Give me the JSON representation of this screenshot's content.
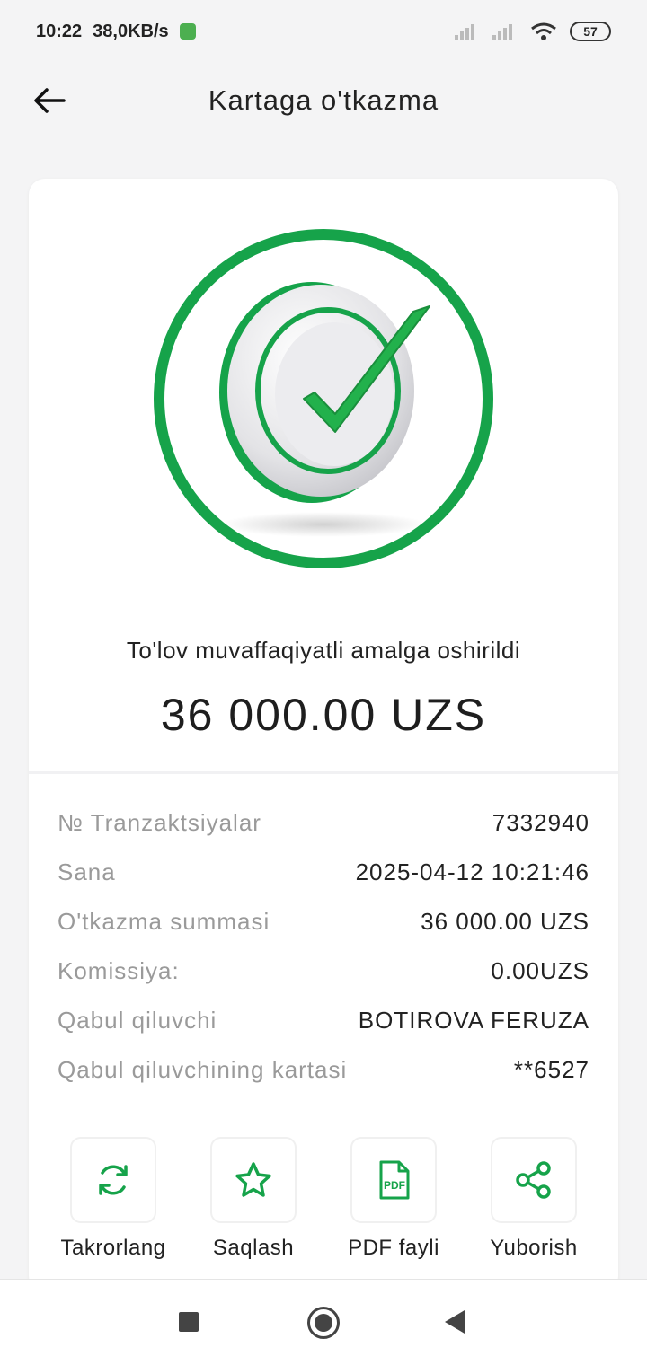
{
  "status_bar": {
    "time": "10:22",
    "speed": "38,0KB/s",
    "battery": "57"
  },
  "header": {
    "title": "Kartaga o'tkazma"
  },
  "result": {
    "message": "To'lov muvaffaqiyatli amalga oshirildi",
    "amount": "36 000.00 UZS",
    "accent_color": "#16a34a"
  },
  "details": [
    {
      "label": "№ Tranzaktsiyalar",
      "value": "7332940"
    },
    {
      "label": "Sana",
      "value": "2025-04-12 10:21:46"
    },
    {
      "label": "O'tkazma summasi",
      "value": "36 000.00 UZS"
    },
    {
      "label": "Komissiya:",
      "value": "0.00UZS"
    },
    {
      "label": "Qabul qiluvchi",
      "value": "BOTIROVA FERUZA"
    },
    {
      "label": "Qabul qiluvchining kartasi",
      "value": "**6527"
    }
  ],
  "actions": [
    {
      "label": "Takrorlang",
      "icon": "refresh-icon"
    },
    {
      "label": "Saqlash",
      "icon": "star-icon"
    },
    {
      "label": "PDF fayli",
      "icon": "pdf-icon",
      "icon_text": "PDF"
    },
    {
      "label": "Yuborish",
      "icon": "share-icon"
    }
  ]
}
